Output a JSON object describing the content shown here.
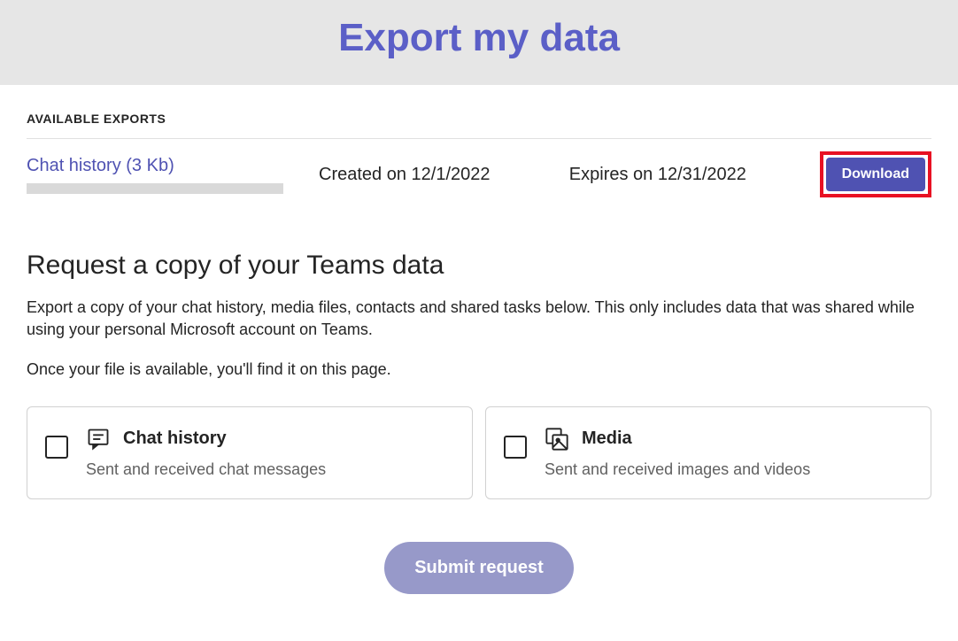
{
  "header": {
    "title": "Export my data"
  },
  "available": {
    "label": "AVAILABLE EXPORTS",
    "item": {
      "name": "Chat history (3 Kb)",
      "created": "Created on 12/1/2022",
      "expires": "Expires on 12/31/2022",
      "download": "Download"
    }
  },
  "request": {
    "title": "Request a copy of your Teams data",
    "para1": "Export a copy of your chat history, media files, contacts and shared tasks below. This only includes data that was shared while using your personal Microsoft account on Teams.",
    "para2": "Once your file is available, you'll find it on this page.",
    "options": {
      "chat": {
        "title": "Chat history",
        "desc": "Sent and received chat messages"
      },
      "media": {
        "title": "Media",
        "desc": "Sent and received images and videos"
      }
    },
    "submit": "Submit request"
  }
}
